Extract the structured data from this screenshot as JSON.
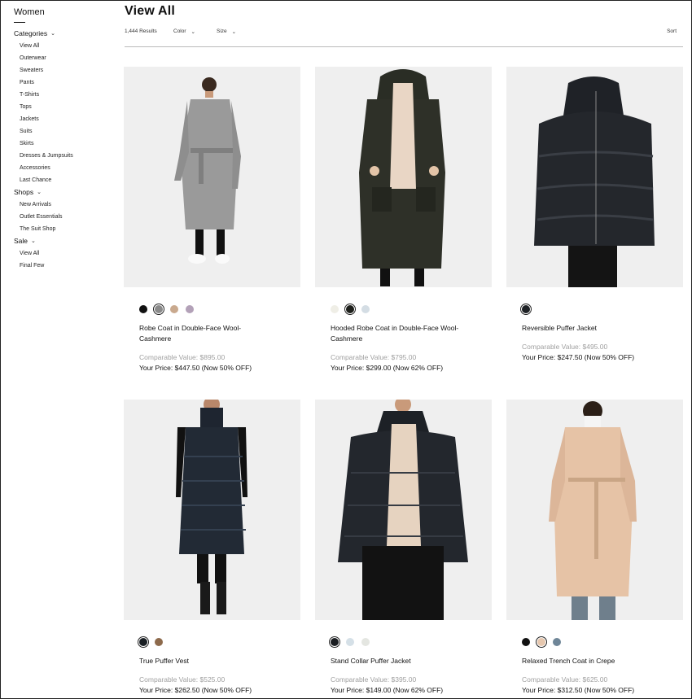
{
  "sidebar": {
    "title": "Women",
    "categories_label": "Categories",
    "categories": [
      "View All",
      "Outerwear",
      "Sweaters",
      "Pants",
      "T-Shirts",
      "Tops",
      "Jackets",
      "Suits",
      "Skirts",
      "Dresses & Jumpsuits",
      "Accessories",
      "Last Chance"
    ],
    "shops_label": "Shops",
    "shops": [
      "New Arrivals",
      "Outlet Essentials",
      "The Suit Shop"
    ],
    "sale_label": "Sale",
    "sale": [
      "View All",
      "Final Few"
    ]
  },
  "header": {
    "title": "View All",
    "results": "1,444 Results",
    "color_label": "Color",
    "size_label": "Size",
    "sort_label": "Sort"
  },
  "products": [
    {
      "name": "Robe Coat in Double-Face Wool-Cashmere",
      "comparable": "Comparable Value: $895.00",
      "price": "Your Price: $447.50 (Now 50% OFF)",
      "swatches": [
        "#111111",
        "#8a8a8a",
        "#c9a98e",
        "#b3a1b8"
      ],
      "selected": 1
    },
    {
      "name": "Hooded Robe Coat in Double-Face Wool-Cashmere",
      "comparable": "Comparable Value: $795.00",
      "price": "Your Price: $299.00 (Now 62% OFF)",
      "swatches": [
        "#efeee6",
        "#1d1f1b",
        "#d4dde4"
      ],
      "selected": 1
    },
    {
      "name": "Reversible Puffer Jacket",
      "comparable": "Comparable Value: $495.00",
      "price": "Your Price: $247.50 (Now 50% OFF)",
      "swatches": [
        "#1e2226"
      ],
      "selected": 0
    },
    {
      "name": "True Puffer Vest",
      "comparable": "Comparable Value: $525.00",
      "price": "Your Price: $262.50 (Now 50% OFF)",
      "swatches": [
        "#1a1f24",
        "#8d6a4c"
      ],
      "selected": 0
    },
    {
      "name": "Stand Collar Puffer Jacket",
      "comparable": "Comparable Value: $395.00",
      "price": "Your Price: $149.00 (Now 62% OFF)",
      "swatches": [
        "#1b1e22",
        "#d5e0e7",
        "#e4e6e1"
      ],
      "selected": 0
    },
    {
      "name": "Relaxed Trench Coat in Crepe",
      "comparable": "Comparable Value: $625.00",
      "price": "Your Price: $312.50 (Now 50% OFF)",
      "swatches": [
        "#111111",
        "#e6c7ae",
        "#6f8698"
      ],
      "selected": 1
    }
  ]
}
